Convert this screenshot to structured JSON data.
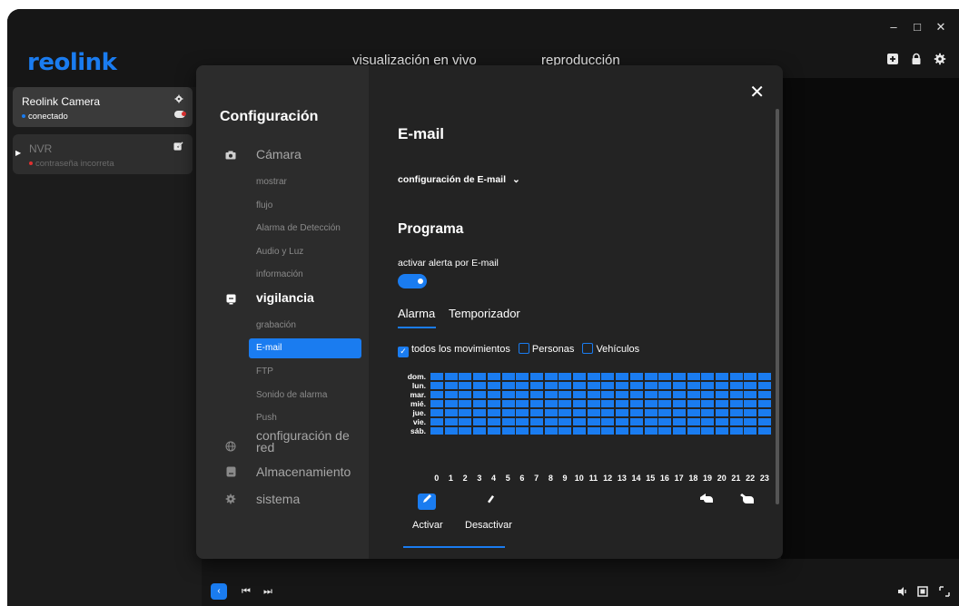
{
  "app": {
    "logo": "reolink"
  },
  "nav": {
    "live": "visualización en vivo",
    "playback": "reproducción"
  },
  "window_controls": {
    "minimize": "–",
    "maximize": "□",
    "close": "✕"
  },
  "devices": [
    {
      "name": "Reolink Camera",
      "status": "conectado",
      "status_color": "#1a7cf0"
    },
    {
      "name": "NVR",
      "status": "contraseña incorreta",
      "status_color": "#e03030"
    }
  ],
  "settings": {
    "title": "Configuración",
    "sections": [
      {
        "label": "Cámara",
        "icon": "camera-icon",
        "items": [
          "mostrar",
          "flujo",
          "Alarma de Detección",
          "Audio y Luz",
          "información"
        ]
      },
      {
        "label": "vigilancia",
        "icon": "monitor-icon",
        "items": [
          "grabación",
          "E-mail",
          "FTP",
          "Sonido de alarma",
          "Push"
        ]
      },
      {
        "label": "configuración de red",
        "icon": "globe-icon"
      },
      {
        "label": "Almacenamiento",
        "icon": "storage-icon"
      },
      {
        "label": "sistema",
        "icon": "gear-icon"
      }
    ],
    "active_item": "E-mail"
  },
  "email": {
    "heading": "E-mail",
    "config_dropdown": "configuración de E-mail",
    "schedule_heading": "Programa",
    "toggle_label": "activar alerta por E-mail",
    "toggle_on": true,
    "tabs": [
      "Alarma",
      "Temporizador"
    ],
    "active_tab": "Alarma",
    "filters": [
      {
        "label": "todos los movimientos",
        "checked": true
      },
      {
        "label": "Personas",
        "checked": false
      },
      {
        "label": "Vehículos",
        "checked": false
      }
    ],
    "days": [
      "dom.",
      "lun.",
      "mar.",
      "mié.",
      "jue.",
      "vie.",
      "sáb."
    ],
    "hours": [
      "0",
      "1",
      "2",
      "3",
      "4",
      "5",
      "6",
      "7",
      "8",
      "9",
      "10",
      "11",
      "12",
      "13",
      "14",
      "15",
      "16",
      "17",
      "18",
      "19",
      "20",
      "21",
      "22",
      "23"
    ],
    "schedule_all_active": true,
    "activate_label": "Activar",
    "deactivate_label": "Desactivar"
  },
  "colors": {
    "accent": "#1a7cf0",
    "error": "#e03030",
    "bg": "#161616"
  }
}
